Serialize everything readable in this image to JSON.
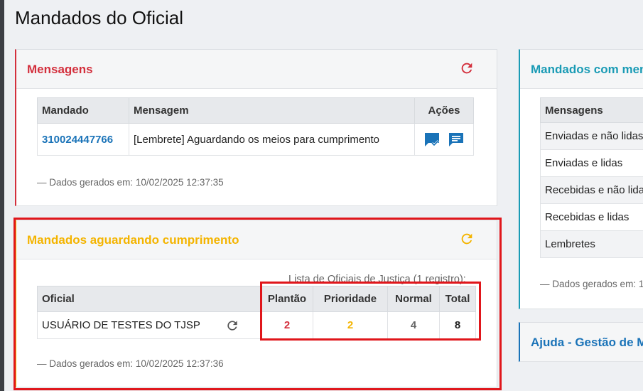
{
  "page": {
    "title": "Mandados do Oficial"
  },
  "mensagens": {
    "title": "Mensagens",
    "title_color": "#d32f3c",
    "columns": [
      "Mandado",
      "Mensagem",
      "Ações"
    ],
    "rows": [
      {
        "mandado": "310024447766",
        "mensagem": "[Lembrete] Aguardando os meios para cumprimento"
      }
    ],
    "generated": "— Dados gerados em: 10/02/2025 12:37:35"
  },
  "aguardando": {
    "title": "Mandados aguardando cumprimento",
    "title_color": "#f4b400",
    "caption": "Lista de Oficiais de Justiça (1 registro):",
    "columns": [
      "Oficial",
      "Plantão",
      "Prioridade",
      "Normal",
      "Total"
    ],
    "rows": [
      {
        "oficial": "USUÁRIO DE TESTES DO TJSP",
        "plantao": "2",
        "prioridade": "2",
        "normal": "4",
        "total": "8"
      }
    ],
    "generated": "— Dados gerados em: 10/02/2025 12:37:36"
  },
  "mensagens_mandados": {
    "title": "Mandados com men",
    "title_color": "#1a9bb5",
    "column": "Mensagens",
    "rows": [
      "Enviadas e não lidas",
      "Enviadas e lidas",
      "Recebidas e não lida",
      "Recebidas e lidas",
      "Lembretes"
    ],
    "generated": "— Dados gerados em: 1"
  },
  "ajuda": {
    "title": "Ajuda - Gestão de M",
    "title_color": "#1a73b8"
  },
  "colors": {
    "highlight": "#e0161b",
    "plantao": "#d32f3c",
    "prioridade": "#f4b400",
    "normal": "#666666"
  }
}
